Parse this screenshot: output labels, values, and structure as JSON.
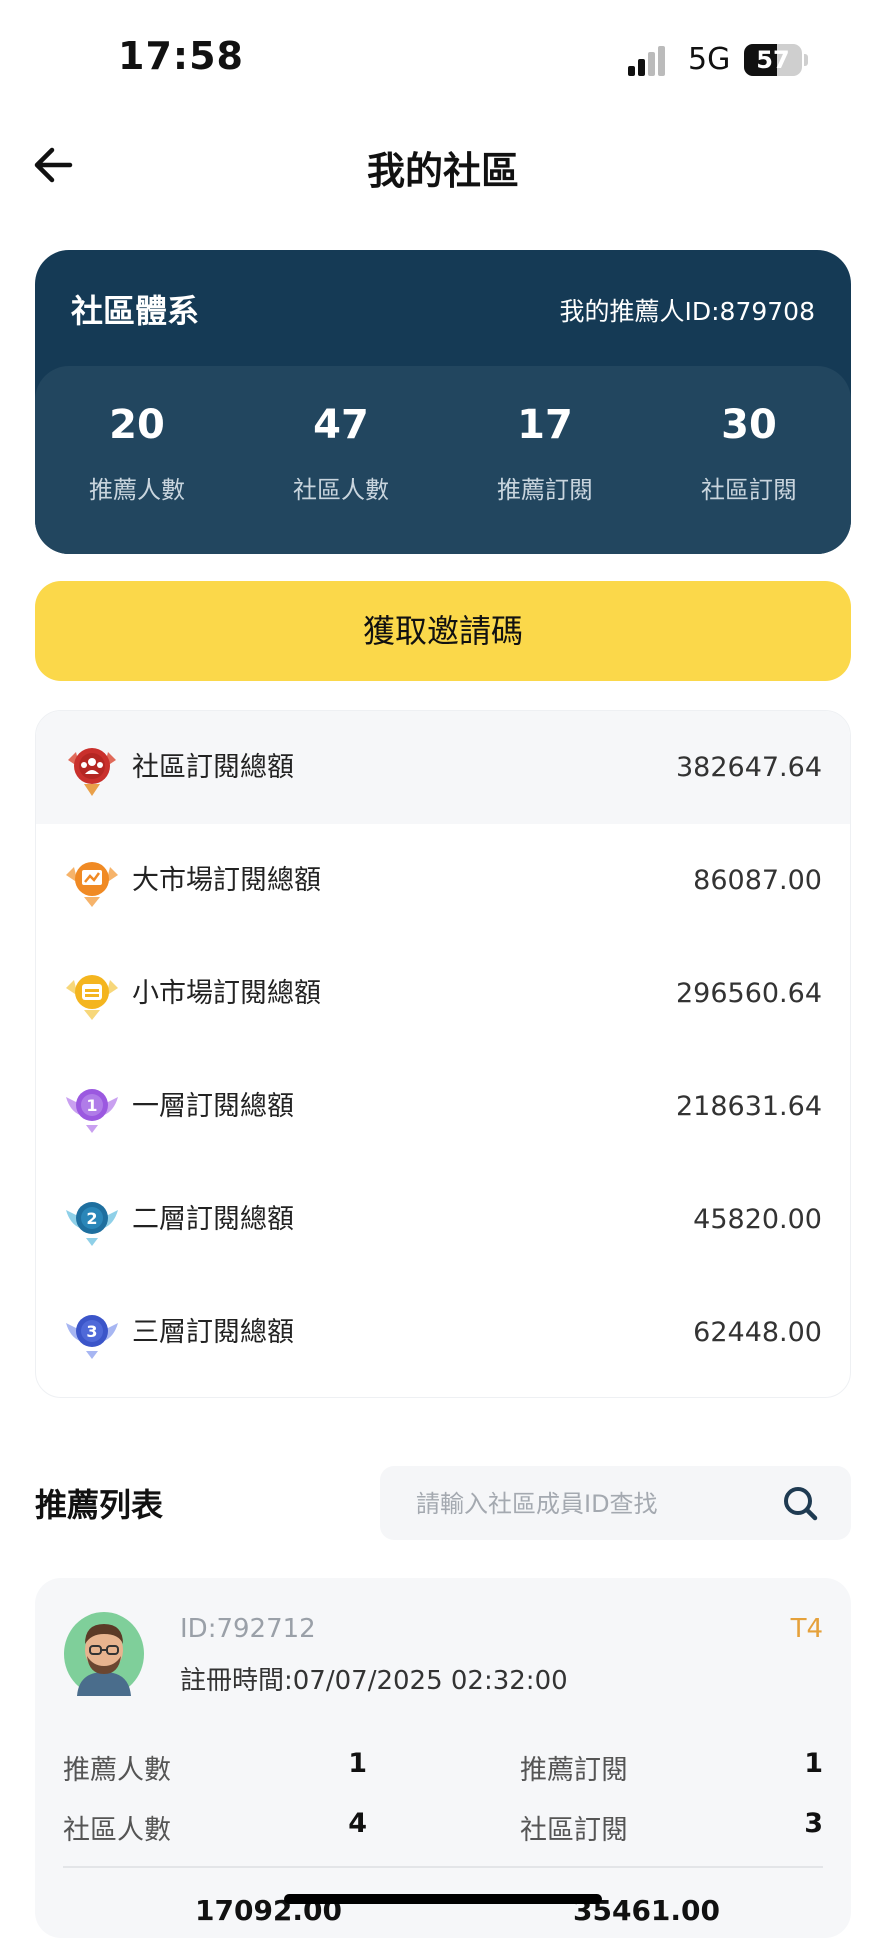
{
  "status_bar": {
    "time": "17:58",
    "network": "5G",
    "battery": "57",
    "battery_level": 0.57
  },
  "header": {
    "title": "我的社區",
    "back_icon": "arrow-left-icon"
  },
  "community": {
    "title": "社區體系",
    "referrer_id": "我的推薦人ID:879708",
    "stats": [
      {
        "value": "20",
        "label": "推薦人數"
      },
      {
        "value": "47",
        "label": "社區人數"
      },
      {
        "value": "17",
        "label": "推薦訂閱"
      },
      {
        "value": "30",
        "label": "社區訂閱"
      }
    ]
  },
  "invite_button": {
    "label": "獲取邀請碼"
  },
  "totals": [
    {
      "label": "社區訂閱總額",
      "value": "382647.64",
      "icon": "people-badge-icon",
      "color": "#c9302c"
    },
    {
      "label": "大市場訂閱總額",
      "value": "86087.00",
      "icon": "chart-badge-icon",
      "color": "#f08a24"
    },
    {
      "label": "小市場訂閱總額",
      "value": "296560.64",
      "icon": "market-badge-icon",
      "color": "#f4b51f"
    },
    {
      "label": "一層訂閱總額",
      "value": "218631.64",
      "icon": "level-1-badge-icon",
      "number": "1",
      "color": "#9b59e0"
    },
    {
      "label": "二層訂閱總額",
      "value": "45820.00",
      "icon": "level-2-badge-icon",
      "number": "2",
      "color": "#1e6f9f"
    },
    {
      "label": "三層訂閱總額",
      "value": "62448.00",
      "icon": "level-3-badge-icon",
      "number": "3",
      "color": "#3b55c9"
    }
  ],
  "referrals": {
    "title": "推薦列表",
    "search_placeholder": "請輸入社區成員ID查找",
    "members": [
      {
        "id": "ID:792712",
        "level": "T4",
        "registered": "註冊時間:07/07/2025 02:32:00",
        "stats": [
          {
            "label": "推薦人數",
            "value": "1"
          },
          {
            "label": "推薦訂閱",
            "value": "1"
          },
          {
            "label": "社區人數",
            "value": "4"
          },
          {
            "label": "社區訂閱",
            "value": "3"
          }
        ],
        "totals": [
          "17092.00",
          "35461.00"
        ]
      }
    ]
  }
}
